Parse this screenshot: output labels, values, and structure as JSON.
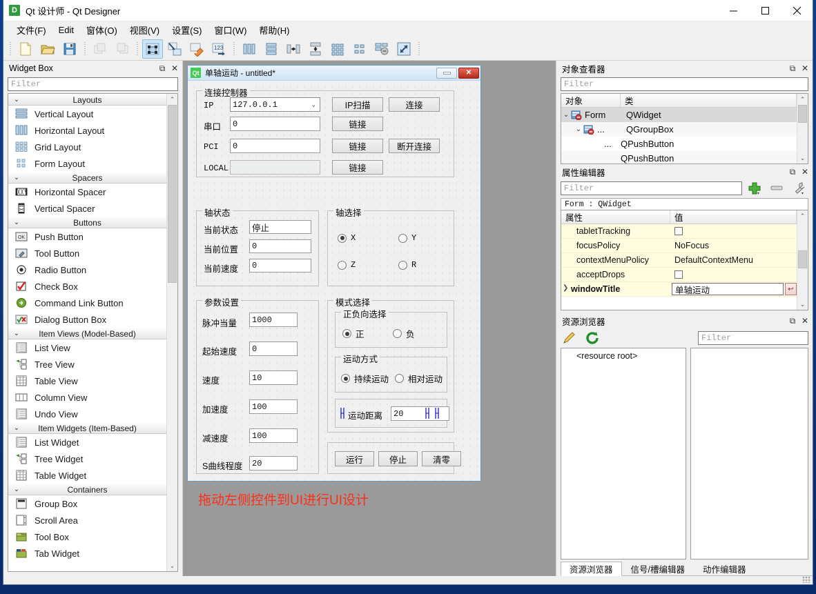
{
  "window": {
    "app_icon_label": "D",
    "title": "Qt 设计师 - Qt Designer",
    "minimize_label": "–",
    "maximize_label": "□",
    "close_label": "✕"
  },
  "menubar": {
    "items": [
      {
        "label": "文件(F)"
      },
      {
        "label": "Edit"
      },
      {
        "label": "窗体(O)"
      },
      {
        "label": "视图(V)"
      },
      {
        "label": "设置(S)"
      },
      {
        "label": "窗口(W)"
      },
      {
        "label": "帮助(H)"
      }
    ]
  },
  "toolbar": {
    "groups": [
      {
        "buttons": [
          {
            "name": "new-form",
            "label": "新建"
          },
          {
            "name": "open-form",
            "label": "打开"
          },
          {
            "name": "save-form",
            "label": "保存"
          }
        ]
      },
      {
        "buttons": [
          {
            "name": "undo",
            "label": "撤销"
          },
          {
            "name": "redo",
            "label": "重做"
          }
        ]
      },
      {
        "buttons": [
          {
            "name": "edit-widgets",
            "label": "编辑控件"
          },
          {
            "name": "edit-signals-slots",
            "label": "编辑信号/槽"
          },
          {
            "name": "edit-buddies",
            "label": "编辑伙伴"
          },
          {
            "name": "edit-tab-order",
            "label": "编辑Tab顺序"
          }
        ]
      },
      {
        "buttons": [
          {
            "name": "layout-horizontally",
            "label": "水平布局"
          },
          {
            "name": "layout-vertically",
            "label": "垂直布局"
          },
          {
            "name": "layout-splitter-h",
            "label": "水平分裂器布局"
          },
          {
            "name": "layout-splitter-v",
            "label": "垂直分裂器布局"
          },
          {
            "name": "layout-grid",
            "label": "栅格布局"
          },
          {
            "name": "layout-form",
            "label": "表单布局"
          },
          {
            "name": "break-layout",
            "label": "打破布局"
          },
          {
            "name": "adjust-size",
            "label": "调整大小"
          }
        ]
      }
    ]
  },
  "widget_box": {
    "title": "Widget Box",
    "filter_placeholder": "Filter",
    "float_label": "⧉",
    "close_label": "✕",
    "groups": [
      {
        "label": "Layouts",
        "items": [
          {
            "label": "Vertical Layout",
            "icon": "vertical-layout-icon"
          },
          {
            "label": "Horizontal Layout",
            "icon": "horizontal-layout-icon"
          },
          {
            "label": "Grid Layout",
            "icon": "grid-layout-icon"
          },
          {
            "label": "Form Layout",
            "icon": "form-layout-icon"
          }
        ]
      },
      {
        "label": "Spacers",
        "items": [
          {
            "label": "Horizontal Spacer",
            "icon": "horizontal-spacer-icon"
          },
          {
            "label": "Vertical Spacer",
            "icon": "vertical-spacer-icon"
          }
        ]
      },
      {
        "label": "Buttons",
        "items": [
          {
            "label": "Push Button",
            "icon": "push-button-icon"
          },
          {
            "label": "Tool Button",
            "icon": "tool-button-icon"
          },
          {
            "label": "Radio Button",
            "icon": "radio-button-icon"
          },
          {
            "label": "Check Box",
            "icon": "check-box-icon"
          },
          {
            "label": "Command Link Button",
            "icon": "command-link-button-icon"
          },
          {
            "label": "Dialog Button Box",
            "icon": "dialog-button-box-icon"
          }
        ]
      },
      {
        "label": "Item Views (Model-Based)",
        "items": [
          {
            "label": "List View",
            "icon": "list-view-icon"
          },
          {
            "label": "Tree View",
            "icon": "tree-view-icon"
          },
          {
            "label": "Table View",
            "icon": "table-view-icon"
          },
          {
            "label": "Column View",
            "icon": "column-view-icon"
          },
          {
            "label": "Undo View",
            "icon": "undo-view-icon"
          }
        ]
      },
      {
        "label": "Item Widgets (Item-Based)",
        "items": [
          {
            "label": "List Widget",
            "icon": "list-widget-icon"
          },
          {
            "label": "Tree Widget",
            "icon": "tree-widget-icon"
          },
          {
            "label": "Table Widget",
            "icon": "table-widget-icon"
          }
        ]
      },
      {
        "label": "Containers",
        "items": [
          {
            "label": "Group Box",
            "icon": "group-box-icon"
          },
          {
            "label": "Scroll Area",
            "icon": "scroll-area-icon"
          },
          {
            "label": "Tool Box",
            "icon": "tool-box-icon"
          },
          {
            "label": "Tab Widget",
            "icon": "tab-widget-icon"
          }
        ]
      }
    ]
  },
  "form": {
    "badge": "Qt",
    "title": "单轴运动 - untitled*",
    "minimize_label": "—",
    "close_label": "✕",
    "hint": "拖动左侧控件到UI进行UI设计",
    "connection_group": {
      "title": "连接控制器",
      "rows": [
        {
          "label": "IP",
          "value": "127.0.0.1",
          "kind": "combo"
        },
        {
          "label": "串口",
          "value": "0",
          "kind": "text"
        },
        {
          "label": "PCI",
          "value": "0",
          "kind": "text"
        },
        {
          "label": "LOCAL",
          "value": "",
          "kind": "text-disabled"
        }
      ],
      "buttons": {
        "ip_scan": "IP扫描",
        "connect": "连接",
        "link_serial": "链接",
        "link_pci": "链接",
        "link_local": "链接",
        "disconnect": "断开连接"
      }
    },
    "axis_status_group": {
      "title": "轴状态",
      "rows": [
        {
          "label": "当前状态",
          "value": "停止"
        },
        {
          "label": "当前位置",
          "value": "0"
        },
        {
          "label": "当前速度",
          "value": "0"
        }
      ]
    },
    "axis_select_group": {
      "title": "轴选择",
      "options": [
        {
          "label": "X",
          "checked": true
        },
        {
          "label": "Y",
          "checked": false
        },
        {
          "label": "Z",
          "checked": false
        },
        {
          "label": "R",
          "checked": false
        }
      ]
    },
    "param_group": {
      "title": "参数设置",
      "rows": [
        {
          "label": "脉冲当量",
          "value": "1000"
        },
        {
          "label": "起始速度",
          "value": "0"
        },
        {
          "label": "速度",
          "value": "10"
        },
        {
          "label": "加速度",
          "value": "100"
        },
        {
          "label": "减速度",
          "value": "100"
        },
        {
          "label": "S曲线程度",
          "value": "20"
        }
      ]
    },
    "mode_group": {
      "title": "模式选择",
      "direction": {
        "title": "正负向选择",
        "options": [
          {
            "label": "正",
            "checked": true
          },
          {
            "label": "负",
            "checked": false
          }
        ]
      },
      "motion": {
        "title": "运动方式",
        "options": [
          {
            "label": "持续运动",
            "checked": true
          },
          {
            "label": "相对运动",
            "checked": false
          }
        ]
      },
      "distance": {
        "label": "运动距离",
        "value": "20"
      }
    },
    "action_buttons": [
      {
        "label": "运行",
        "name": "run-button"
      },
      {
        "label": "停止",
        "name": "stop-button"
      },
      {
        "label": "清零",
        "name": "reset-button"
      }
    ]
  },
  "object_inspector": {
    "title": "对象查看器",
    "float_label": "⧉",
    "close_label": "✕",
    "filter_placeholder": "Filter",
    "columns": [
      "对象",
      "类"
    ],
    "rows": [
      {
        "name": "Form",
        "class": "QWidget",
        "depth": 0,
        "expanded": true,
        "selected": true,
        "has_icon": true
      },
      {
        "name": "...",
        "class": "QGroupBox",
        "depth": 1,
        "expanded": true,
        "selected": false,
        "has_icon": true
      },
      {
        "name": "...",
        "class": "QPushButton",
        "depth": 2,
        "expanded": false,
        "selected": false,
        "has_icon": false
      },
      {
        "name": "",
        "class": "QPushButton",
        "depth": 2,
        "expanded": false,
        "selected": false,
        "has_icon": false
      }
    ]
  },
  "property_editor": {
    "title": "属性编辑器",
    "float_label": "⧉",
    "close_label": "✕",
    "filter_placeholder": "Filter",
    "add_label": "+",
    "remove_label": "—",
    "configure_label": "🔧",
    "object_line": "Form : QWidget",
    "columns": [
      "属性",
      "值"
    ],
    "rows": [
      {
        "key": "tabletTracking",
        "value": "",
        "type": "checkbox",
        "checked": false,
        "bold": false
      },
      {
        "key": "focusPolicy",
        "value": "NoFocus",
        "type": "text",
        "bold": false
      },
      {
        "key": "contextMenuPolicy",
        "value": "DefaultContextMenu",
        "type": "text",
        "bold": false
      },
      {
        "key": "acceptDrops",
        "value": "",
        "type": "checkbox",
        "checked": false,
        "bold": false
      },
      {
        "key": "windowTitle",
        "value": "单轴运动",
        "type": "editing",
        "bold": true
      }
    ]
  },
  "resource_browser": {
    "title": "资源浏览器",
    "float_label": "⧉",
    "close_label": "✕",
    "edit_label": "✎",
    "reload_label": "⟳",
    "filter_placeholder": "Filter",
    "root_label": "<resource root>",
    "tabs": [
      {
        "label": "资源浏览器",
        "active": true
      },
      {
        "label": "信号/槽编辑器",
        "active": false
      },
      {
        "label": "动作编辑器",
        "active": false
      }
    ]
  },
  "colors": {
    "accent_blue": "#0d3d8f",
    "form_border": "#5e9bc9",
    "hint_red": "#ff2d17",
    "property_row_bg": "#fffce0",
    "qt_green": "#41cd52",
    "canvas_gray": "#9a9a9a"
  }
}
